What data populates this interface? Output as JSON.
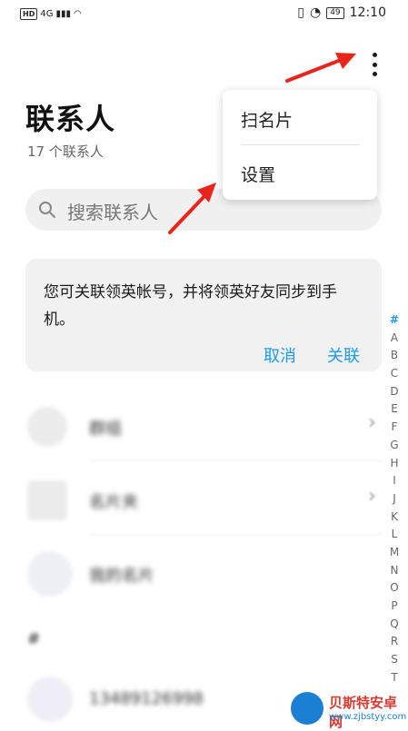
{
  "status_bar": {
    "left_badge": "HD",
    "network": "4G",
    "battery": "49",
    "time": "12:10"
  },
  "header": {
    "title": "联系人",
    "count_text": "17 个联系人"
  },
  "search": {
    "placeholder": "搜索联系人"
  },
  "overflow_menu": {
    "items": [
      {
        "label": "扫名片"
      },
      {
        "label": "设置"
      }
    ]
  },
  "banner": {
    "message": "您可关联领英帐号，并将领英好友同步到手机。",
    "cancel_label": "取消",
    "link_label": "关联"
  },
  "contact_list": {
    "rows": [
      {
        "label": "群组",
        "chevron": "›"
      },
      {
        "label": "名片夹",
        "chevron": "›"
      },
      {
        "label": "我的名片"
      }
    ],
    "section_header": "#",
    "contacts": [
      {
        "label": "13489126998"
      }
    ]
  },
  "alphabet_index": [
    "#",
    "A",
    "B",
    "C",
    "D",
    "E",
    "F",
    "G",
    "H",
    "I",
    "J",
    "K",
    "L",
    "M",
    "N",
    "O",
    "P",
    "Q",
    "R",
    "S",
    "T"
  ],
  "watermark": {
    "title": "贝斯特安卓网",
    "url": "www.zjbstyy.com"
  },
  "colors": {
    "accent": "#1e9be6",
    "annotation_arrow": "#e8241c",
    "banner_bg": "#f1f1f1",
    "search_bg": "#f0f0f0"
  }
}
